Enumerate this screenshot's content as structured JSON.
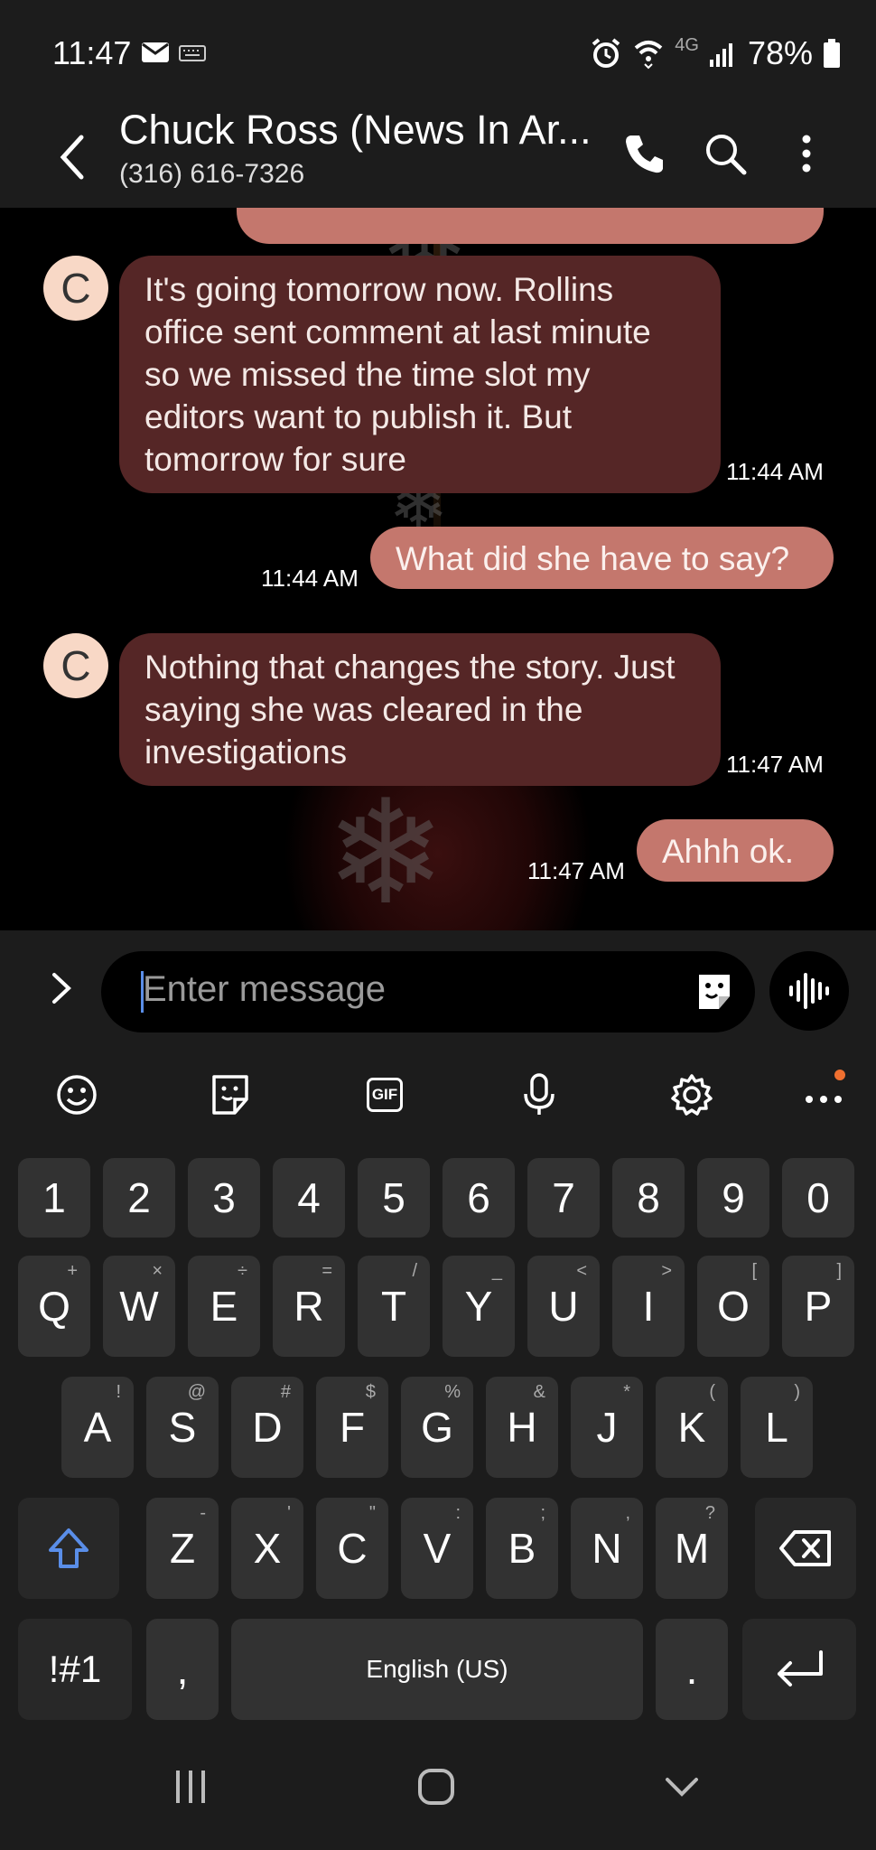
{
  "status": {
    "time": "11:47",
    "network": "4G",
    "battery": "78%"
  },
  "header": {
    "contact_name": "Chuck Ross (News In Ar...",
    "phone": "(316) 616-7326"
  },
  "messages": [
    {
      "dir": "in",
      "avatar": "C",
      "text": "It's going tomorrow now. Rollins office sent comment at last minute so we missed the time slot my editors want to publish it. But tomorrow for sure",
      "time": "11:44 AM"
    },
    {
      "dir": "out",
      "text": "What did she have to say?",
      "time": "11:44 AM"
    },
    {
      "dir": "in",
      "avatar": "C",
      "text": "Nothing that changes the story. Just saying she was cleared in the investigations",
      "time": "11:47 AM"
    },
    {
      "dir": "out",
      "text": "Ahhh ok.",
      "time": "11:47 AM"
    }
  ],
  "composer": {
    "placeholder": "Enter message"
  },
  "keyboard": {
    "toolbar": [
      "emoji-icon",
      "sticker-icon",
      "gif-icon",
      "microphone-icon",
      "gear-icon",
      "more-icon"
    ],
    "gif_label": "GIF",
    "number_row": [
      "1",
      "2",
      "3",
      "4",
      "5",
      "6",
      "7",
      "8",
      "9",
      "0"
    ],
    "row1": [
      {
        "key": "Q",
        "hint": "+"
      },
      {
        "key": "W",
        "hint": "×"
      },
      {
        "key": "E",
        "hint": "÷"
      },
      {
        "key": "R",
        "hint": "="
      },
      {
        "key": "T",
        "hint": "/"
      },
      {
        "key": "Y",
        "hint": "_"
      },
      {
        "key": "U",
        "hint": "<"
      },
      {
        "key": "I",
        "hint": ">"
      },
      {
        "key": "O",
        "hint": "["
      },
      {
        "key": "P",
        "hint": "]"
      }
    ],
    "row2": [
      {
        "key": "A",
        "hint": "!"
      },
      {
        "key": "S",
        "hint": "@"
      },
      {
        "key": "D",
        "hint": "#"
      },
      {
        "key": "F",
        "hint": "$"
      },
      {
        "key": "G",
        "hint": "%"
      },
      {
        "key": "H",
        "hint": "&"
      },
      {
        "key": "J",
        "hint": "*"
      },
      {
        "key": "K",
        "hint": "("
      },
      {
        "key": "L",
        "hint": ")"
      }
    ],
    "row3": [
      {
        "key": "Z",
        "hint": "-"
      },
      {
        "key": "X",
        "hint": "'"
      },
      {
        "key": "C",
        "hint": "\""
      },
      {
        "key": "V",
        "hint": ":"
      },
      {
        "key": "B",
        "hint": ";"
      },
      {
        "key": "N",
        "hint": ","
      },
      {
        "key": "M",
        "hint": "?"
      }
    ],
    "symbols_label": "!#1",
    "comma": ",",
    "space_label": "English (US)",
    "period": "."
  },
  "colors": {
    "incoming_bubble": "#552626",
    "outgoing_bubble": "#c4776d",
    "avatar_bg": "#f8d8c6",
    "accent_blue": "#5a8ee8"
  }
}
